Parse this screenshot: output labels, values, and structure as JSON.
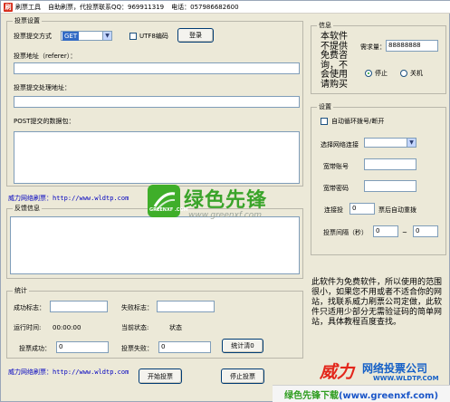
{
  "window": {
    "app_icon": "刷",
    "title": "刷票工具",
    "slogan": "自助刷票，代投票联系QQ：969911319",
    "phone": "电话：057986682600"
  },
  "vote_settings": {
    "group_title": "投票设置",
    "method_label": "投票提交方式",
    "method_value": "GET",
    "utf8_label": "UTF8编码",
    "login_button": "登录",
    "url_label": "投票地址（referer）：",
    "url_value": "",
    "handler_label": "投票提交处理地址：",
    "handler_value": "",
    "post_label": "POST提交的数据包：",
    "post_value": ""
  },
  "link_top": {
    "label": "威力网络刷票：",
    "url": "http://www.wldtp.com"
  },
  "feedback": {
    "group_title": "反馈信息",
    "content": ""
  },
  "stats": {
    "group_title": "统计",
    "success_flag_label": "成功标志：",
    "fail_flag_label": "失败标志：",
    "runtime_label": "运行时间:",
    "runtime_value": "00:00:00",
    "status_label": "当前状态:",
    "status_value": "状态",
    "success_count_label": "投票成功：",
    "success_count_value": "0",
    "fail_count_label": "投票失败：",
    "fail_count_value": "0",
    "reset_button": "统计清0"
  },
  "link_bottom": {
    "label": "威力网络刷票：",
    "url": "http://www.wldtp.com"
  },
  "actions": {
    "start_button": "开始投票",
    "stop_button": "停止投票"
  },
  "info": {
    "group_title": "信息",
    "notice_lines": [
      "本软件",
      "不提供",
      "免费咨",
      "询，不",
      "会使用",
      "请购买"
    ],
    "machine_code_label": "需求量：",
    "machine_code_value": "88888888",
    "stop_label": "停止",
    "shutdown_label": "关机"
  },
  "settings": {
    "group_title": "设置",
    "auto_dial_label": "自动循环拨号/断开",
    "network_label": "选择网络连接",
    "network_value": "",
    "account_label": "宽带账号",
    "account_value": "",
    "password_label": "宽带密码",
    "password_value": "",
    "reconnect_label": "连接投",
    "reconnect_value": "0",
    "reconnect_suffix": "票后自动重拨",
    "interval_label": "投票间隔（秒）",
    "interval_from": "0",
    "interval_sep": "~",
    "interval_to": "0"
  },
  "description": "此软件为免费软件，所以使用的范围很小，如果您不用或者不适合你的网站，找联系威力刷票公司定做，此软件只适用少部分无需验证码的简单网站，具体教程百度查找。",
  "branding": {
    "wordmark": "绿色先锋",
    "wordmark_url": "www.greenxf.com",
    "badge_text": "GREENXF .COM",
    "company_red": "威力",
    "company_blue": "网络投票公司",
    "company_url": "WWW.WLDTP.COM",
    "footer_text": "绿色先锋下载(www.greenxf.com)",
    "footer_color_green": "#2e9d1f",
    "footer_color_blue": "#1a55c8"
  }
}
